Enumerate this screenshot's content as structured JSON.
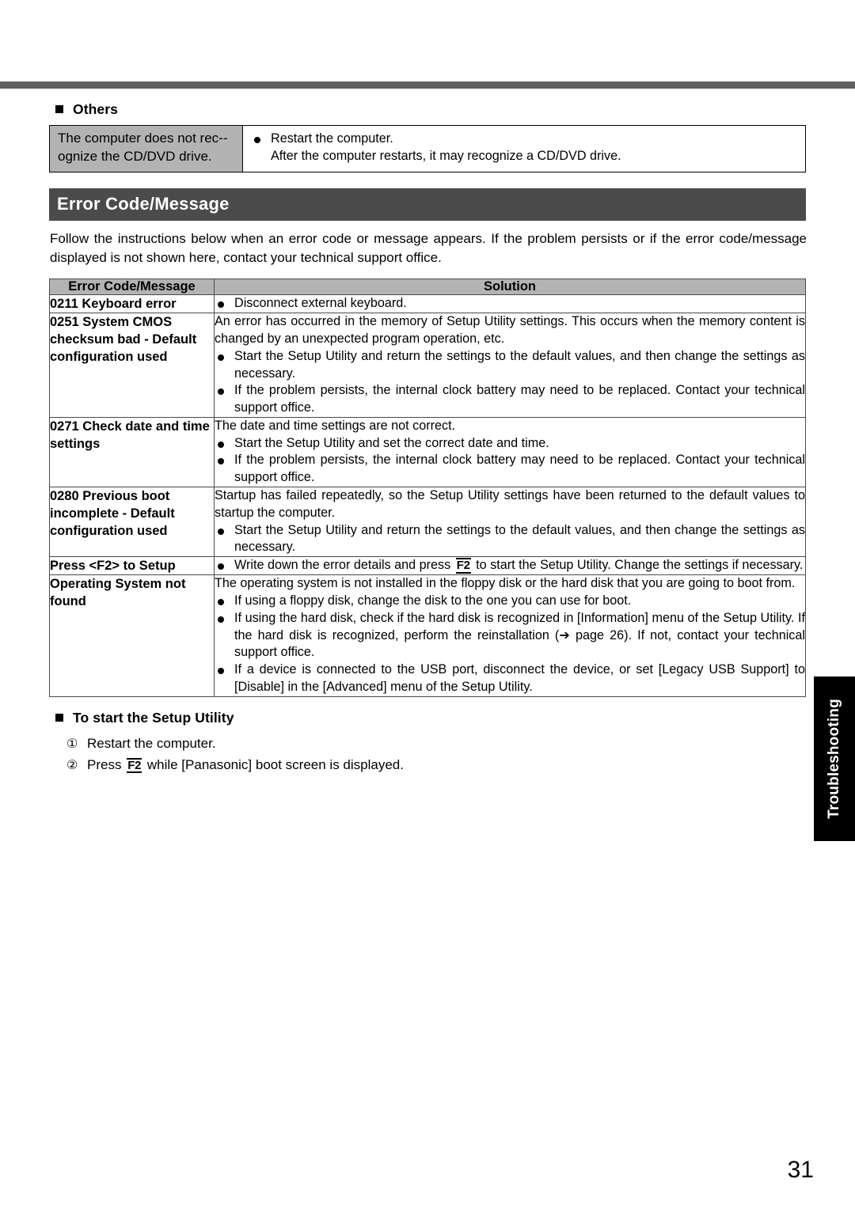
{
  "page": {
    "number": "31",
    "side_tab_label": "Troubleshooting"
  },
  "others_section": {
    "heading": "Others",
    "rows": [
      {
        "symptom": "The computer does not rec-­ognize the CD/DVD drive.",
        "solution_bullets": [
          "Restart the computer.",
          "After the computer restarts, it may recognize a CD/DVD drive."
        ]
      }
    ]
  },
  "error_section": {
    "banner_title": "Error Code/Message",
    "intro": "Follow the instructions below when an error code or message appears. If the problem persists or if the error code/message displayed is not shown here, contact your technical support office.",
    "table": {
      "headers": {
        "code": "Error Code/Message",
        "solution": "Solution"
      },
      "rows": [
        {
          "code": "0211 Keyboard error",
          "intro": "",
          "bullets": [
            "Disconnect external keyboard."
          ]
        },
        {
          "code": "0251 System CMOS checksum bad - Default configuration used",
          "intro": "An error has occurred in the memory of Setup Utility settings. This occurs when the memory content is changed by an unexpected program operation, etc.",
          "bullets": [
            "Start the Setup Utility and return the settings to the default values, and then change the settings as necessary.",
            "If the problem persists, the internal clock battery may need to be replaced. Contact your technical support office."
          ]
        },
        {
          "code": "0271 Check date and time settings",
          "intro": "The date and time settings are not correct.",
          "bullets": [
            "Start the Setup Utility and set the correct date and time.",
            "If the problem persists, the internal clock battery may need to be replaced. Contact your technical support office."
          ]
        },
        {
          "code": "0280 Previous boot incomplete - Default configuration used",
          "intro": "Startup has failed repeatedly, so the Setup Utility settings have been returned to the default values to startup the computer.",
          "bullets": [
            "Start the Setup Utility and return the settings to the default values, and then change the settings as necessary."
          ]
        },
        {
          "code": "Press <F2> to Setup",
          "intro": "",
          "bullets_f2": {
            "before": "Write down the error details and press",
            "key": "F2",
            "after": "to start the Setup Utility. Change the settings if necessary."
          }
        },
        {
          "code": "Operating System not found",
          "intro": "The operating system is not installed in the floppy disk or the hard disk that you are going to boot from.",
          "bullets": [
            "If using a floppy disk, change the disk to the one you can use for boot."
          ],
          "bullet_with_ref": {
            "part1": "If using the hard disk, check if the hard disk is recognized in [Information] menu of the Setup Utility. If the hard disk is recognized, perform the reinstallation (",
            "arrow": "➔",
            "ref": " page 26). If not, contact your technical support office."
          },
          "last_bullet": "If a device is connected to the USB port, disconnect the device, or set [Legacy USB Support] to [Disable] in the [Advanced] menu of the Setup Utility."
        }
      ]
    }
  },
  "setup_section": {
    "heading": "To start the Setup Utility",
    "steps": [
      {
        "num": "①",
        "text": "Restart the computer."
      },
      {
        "num": "②",
        "before": "Press",
        "key": "F2",
        "after": "while [Panasonic] boot screen is displayed."
      }
    ]
  }
}
